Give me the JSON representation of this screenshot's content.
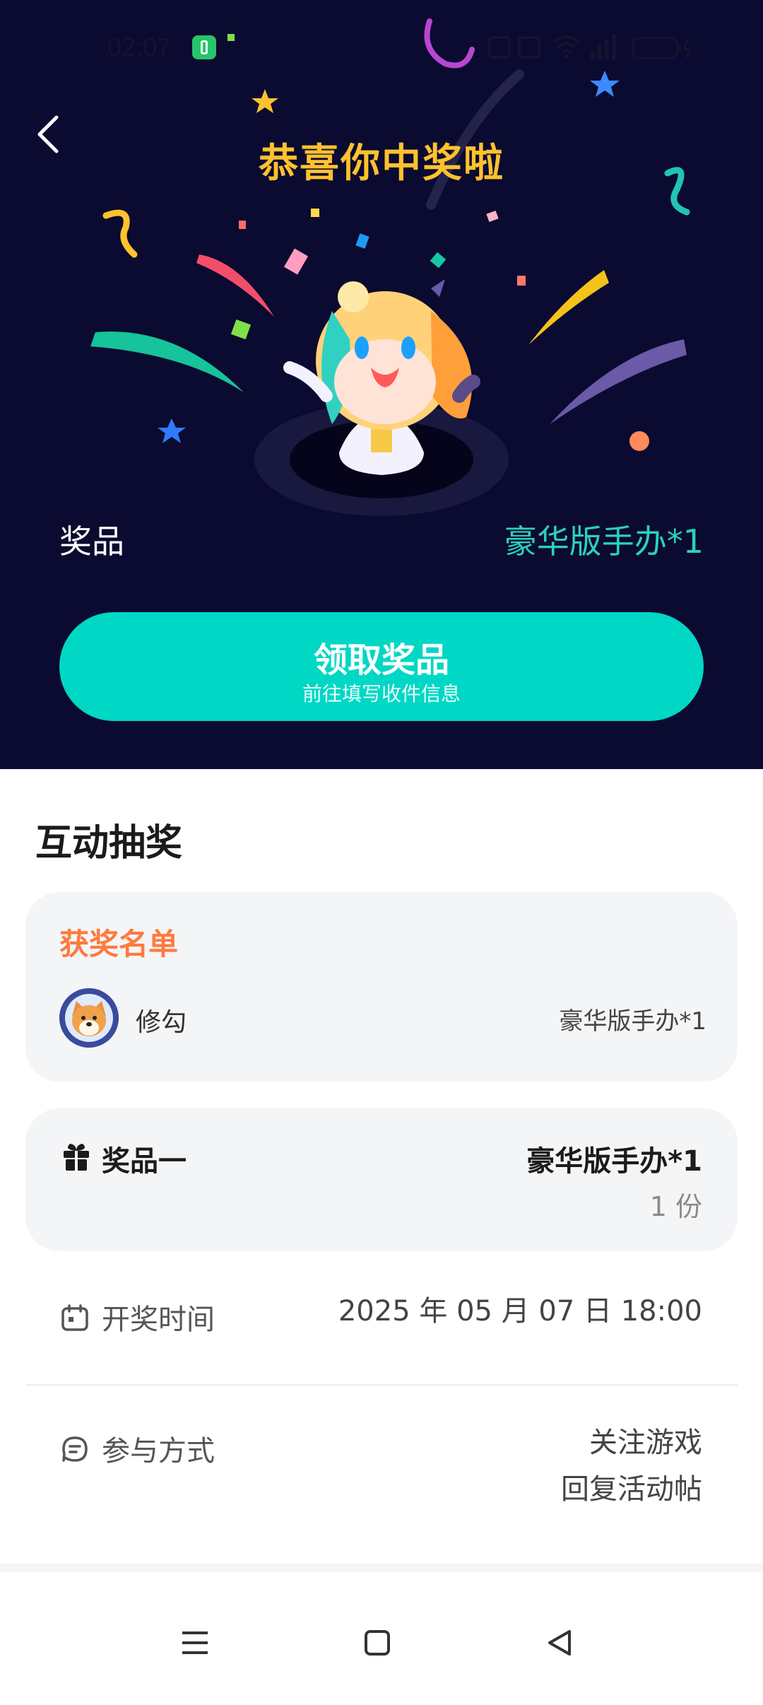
{
  "status_bar": {
    "time": "02:07"
  },
  "hero": {
    "title": "恭喜你中奖啦",
    "prize_label": "奖品",
    "prize_value": "豪华版手办*1",
    "claim_button": {
      "title": "领取奖品",
      "subtitle": "前往填写收件信息"
    }
  },
  "section": {
    "title": "互动抽奖",
    "winners": {
      "heading": "获奖名单",
      "items": [
        {
          "name": "修勾",
          "prize": "豪华版手办*1"
        }
      ]
    },
    "prize_tier": {
      "label": "奖品一",
      "value": "豪华版手办*1",
      "count": "1 份"
    },
    "draw_time": {
      "label": "开奖时间",
      "value": "2025 年 05 月 07 日 18:00"
    },
    "participation": {
      "label": "参与方式",
      "value_line1": "关注游戏",
      "value_line2": "回复活动帖"
    }
  },
  "colors": {
    "hero_bg": "#0b0a30",
    "title_yellow": "#ffc12e",
    "accent_teal": "#00d7c5",
    "winners_orange": "#ff7a3d"
  },
  "icons": [
    "back-icon",
    "gift-icon",
    "calendar-icon",
    "chat-icon",
    "menu-icon",
    "home-icon",
    "back-triangle-icon"
  ]
}
